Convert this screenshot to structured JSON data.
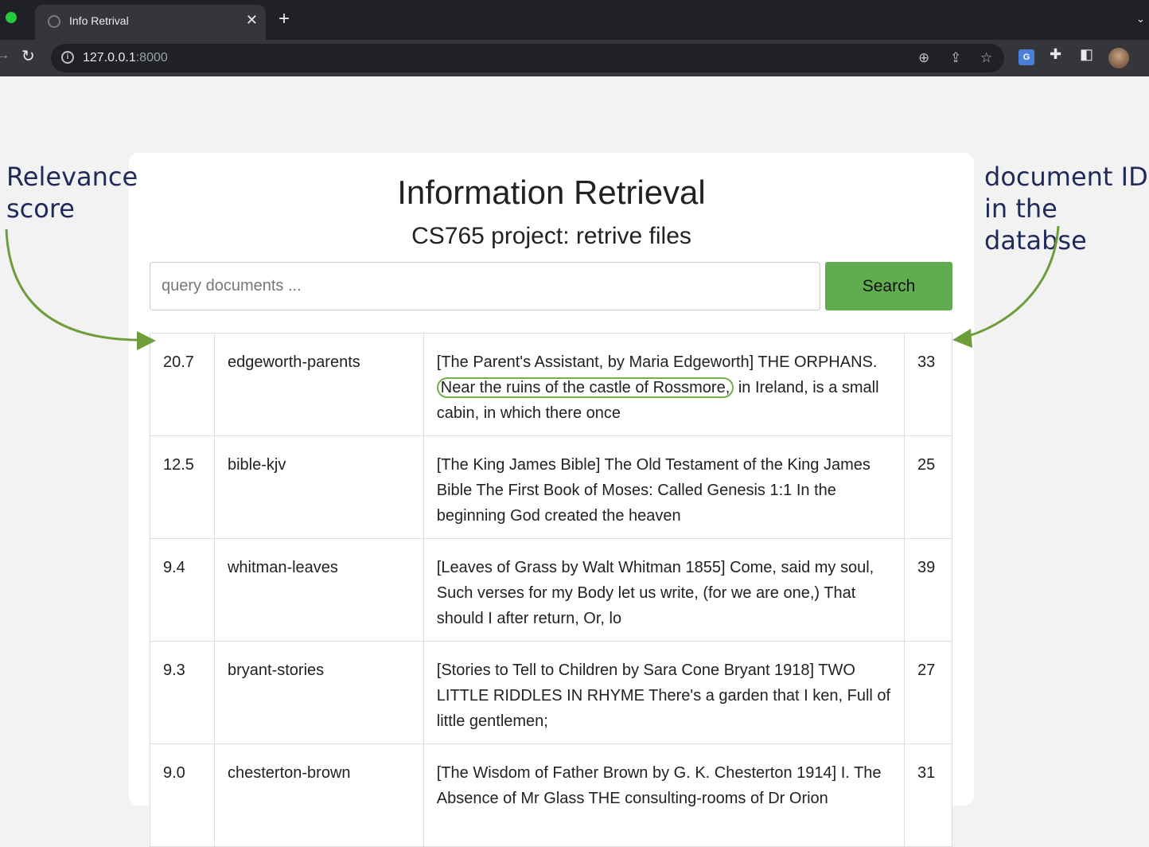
{
  "browser": {
    "tab_title": "Info Retrival",
    "url_host": "127.0.0.1",
    "url_port": ":8000"
  },
  "page": {
    "title": "Information Retrieval",
    "subtitle": "CS765 project: retrive files",
    "search_placeholder": "query documents ...",
    "search_label": "Search"
  },
  "results": [
    {
      "score": "20.7",
      "name": "edgeworth-parents",
      "snippet_pre": "[The Parent's Assistant, by Maria Edgeworth] THE ORPHANS. ",
      "snippet_hl": "Near the ruins of the castle of Rossmore,",
      "snippet_post": " in Ireland, is a small cabin, in which there once",
      "id": "33"
    },
    {
      "score": "12.5",
      "name": "bible-kjv",
      "snippet": "[The King James Bible] The Old Testament of the King James Bible The First Book of Moses: Called Genesis 1:1 In the beginning God created the heaven",
      "id": "25"
    },
    {
      "score": "9.4",
      "name": "whitman-leaves",
      "snippet": "[Leaves of Grass by Walt Whitman 1855] Come, said my soul, Such verses for my Body let us write, (for we are one,) That should I after return, Or, lo",
      "id": "39"
    },
    {
      "score": "9.3",
      "name": "bryant-stories",
      "snippet": "[Stories to Tell to Children by Sara Cone Bryant 1918] TWO LITTLE RIDDLES IN RHYME There's a garden that I ken, Full of little gentlemen;",
      "id": "27"
    },
    {
      "score": "9.0",
      "name": "chesterton-brown",
      "snippet": "[The Wisdom of Father Brown by G. K. Chesterton 1914] I. The Absence of Mr Glass THE consulting-rooms of Dr Orion",
      "id": "31"
    }
  ],
  "annotations": {
    "left_line1": "Relevance",
    "left_line2": "score",
    "right_line1": "document ID",
    "right_line2": "in the databse"
  },
  "colors": {
    "search_button": "#5fad4e",
    "highlight": "#76b04a",
    "annotation_text": "#1f2a5a",
    "doc_id": "#1a1aff"
  }
}
